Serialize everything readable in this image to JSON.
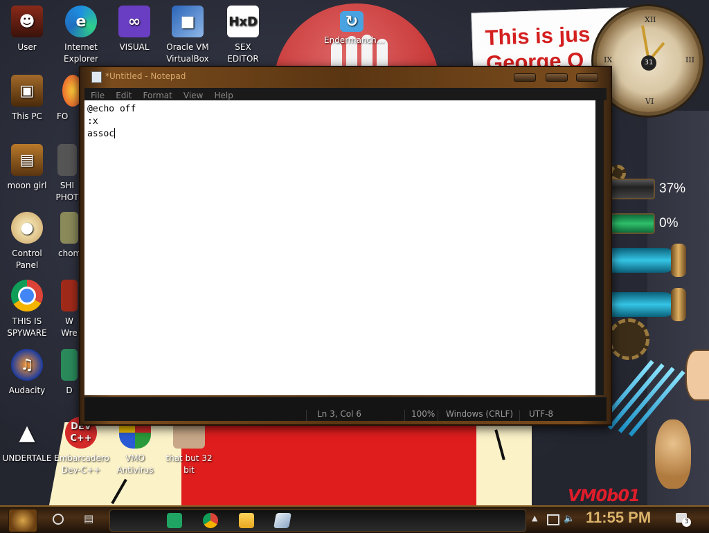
{
  "desktop": {
    "icons": [
      {
        "label": "User",
        "icon": "user-folder-icon"
      },
      {
        "label": "Internet\nExplorer",
        "icon": "edge-browser-icon"
      },
      {
        "label": "VISUAL",
        "icon": "visual-studio-icon"
      },
      {
        "label": "Oracle VM\nVirtualBox",
        "icon": "virtualbox-icon"
      },
      {
        "label": "SEX\nEDITOR",
        "icon": "hex-editor-icon"
      },
      {
        "label": "Endermanch...",
        "icon": "sync-folder-icon"
      },
      {
        "label": "This PC",
        "icon": "computer-icon"
      },
      {
        "label": "FO",
        "icon": "firefox-icon"
      },
      {
        "label": "moon girl",
        "icon": "file-icon"
      },
      {
        "label": "SHI\nPHOT",
        "icon": "gimp-icon"
      },
      {
        "label": "Control Panel",
        "icon": "control-panel-icon"
      },
      {
        "label": "chom",
        "icon": "app-icon"
      },
      {
        "label": "THIS IS\nSPYWARE",
        "icon": "chrome-icon"
      },
      {
        "label": "W\nWre",
        "icon": "app-icon"
      },
      {
        "label": "Audacity",
        "icon": "audacity-icon"
      },
      {
        "label": "D",
        "icon": "app-icon"
      },
      {
        "label": "UNDERTALE",
        "icon": "unity-icon"
      },
      {
        "label": "Embarcadero\nDev-C++",
        "icon": "devcpp-icon"
      },
      {
        "label": "VMO\nAntivirus",
        "icon": "shield-icon"
      },
      {
        "label": "that but 32\nbit",
        "icon": "file-icon"
      }
    ],
    "gauges": {
      "cpu_label": "37%",
      "mem_label": "0%"
    },
    "clock_date": "31"
  },
  "notepad": {
    "title": "*Untitled - Notepad",
    "menu": [
      "File",
      "Edit",
      "Format",
      "View",
      "Help"
    ],
    "content_lines": [
      "@echo off",
      ":x",
      "assoc"
    ],
    "status": {
      "position": "Ln 3, Col 6",
      "zoom": "100%",
      "line_ending": "Windows (CRLF)",
      "encoding": "UTF-8"
    }
  },
  "taskbar": {
    "time": "11:55 PM",
    "notification_count": "3",
    "pinned": [
      "sheets-icon",
      "chrome-icon",
      "file-explorer-icon",
      "notepad-icon"
    ]
  }
}
